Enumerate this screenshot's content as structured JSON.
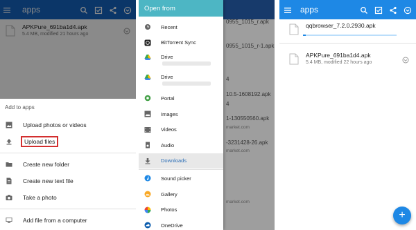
{
  "panel1": {
    "title": "apps",
    "file": {
      "name": "APKPure_691ba1d4.apk",
      "meta": "5.4 MB, modified 21 hours ago"
    },
    "sheet_header": "Add to apps",
    "items": [
      {
        "label": "Upload photos or videos",
        "icon": "image-icon"
      },
      {
        "label": "Upload files",
        "icon": "upload-icon",
        "highlighted": true
      },
      {
        "label": "Create new folder",
        "icon": "folder-icon"
      },
      {
        "label": "Create new text file",
        "icon": "text-file-icon"
      },
      {
        "label": "Take a photo",
        "icon": "camera-icon"
      },
      {
        "label": "Add file from a computer",
        "icon": "computer-icon"
      }
    ]
  },
  "panel2": {
    "drawer_title": "Open from",
    "items": [
      {
        "label": "Recent",
        "icon": "clock-icon"
      },
      {
        "label": "BitTorrent Sync",
        "icon": "sync-icon"
      },
      {
        "label": "Drive",
        "icon": "drive-icon"
      },
      {
        "label": "Drive",
        "icon": "drive-icon"
      },
      {
        "label": "Portal",
        "icon": "portal-icon"
      },
      {
        "label": "Images",
        "icon": "image-icon"
      },
      {
        "label": "Videos",
        "icon": "video-icon"
      },
      {
        "label": "Audio",
        "icon": "audio-icon"
      },
      {
        "label": "Downloads",
        "icon": "download-icon"
      },
      {
        "label": "Sound picker",
        "icon": "music-note-icon"
      },
      {
        "label": "Gallery",
        "icon": "gallery-icon"
      },
      {
        "label": "Photos",
        "icon": "photos-icon"
      },
      {
        "label": "OneDrive",
        "icon": "onedrive-icon"
      }
    ],
    "background_files": [
      {
        "name": "0955_1015_r.apk"
      },
      {
        "name": "0955_1015_r-1.apk"
      },
      {
        "name": "4"
      },
      {
        "name": "10.5-1608192.apk"
      },
      {
        "name": "4"
      },
      {
        "name": "1-130550560.apk",
        "sub": "market.com"
      },
      {
        "name": "-3231428-26.apk",
        "sub": "market.com"
      },
      {
        "name": "market.com"
      }
    ]
  },
  "panel3": {
    "title": "apps",
    "uploading_file": {
      "name": "qqbrowser_7.2.0.2930.apk",
      "progress": 0.03
    },
    "file": {
      "name": "APKPure_691ba1d4.apk",
      "meta": "5.4 MB, modified 22 hours ago"
    },
    "fab": "+"
  },
  "colors": {
    "primary": "#1e88e5",
    "drawer_header": "#4db6c4",
    "highlight": "#d32f2f"
  }
}
